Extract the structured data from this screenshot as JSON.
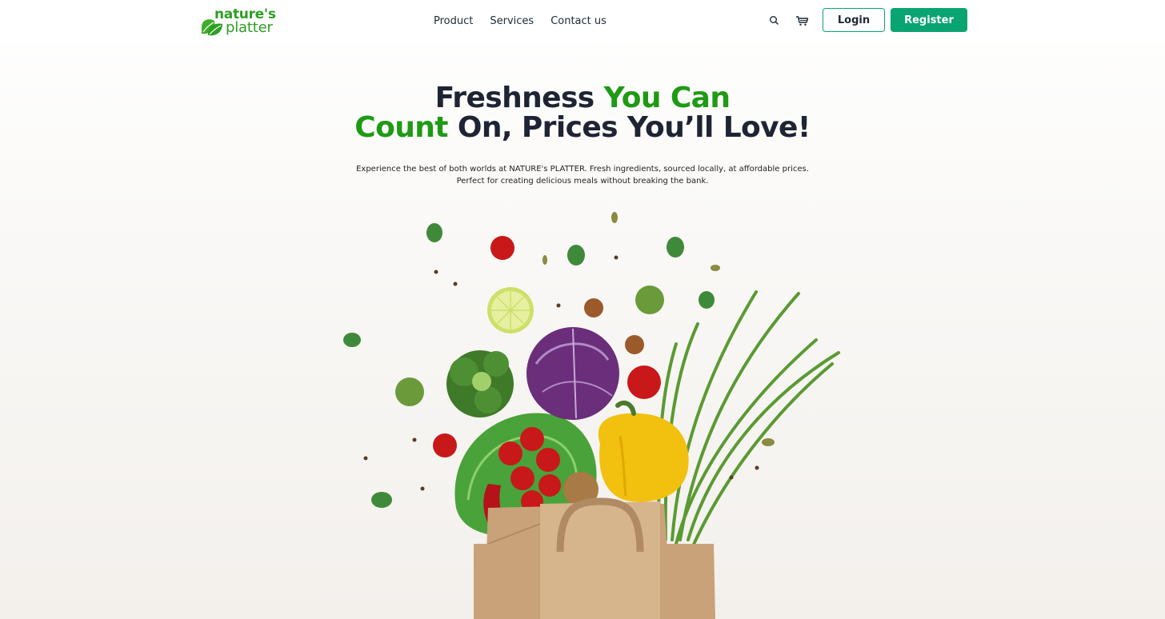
{
  "brand": {
    "line1": "nature's",
    "line2": "platter",
    "color": "#2e9e22"
  },
  "nav": {
    "items": [
      "Product",
      "Services",
      "Contact us"
    ]
  },
  "header_icons": [
    "search-icon",
    "cart-icon"
  ],
  "auth": {
    "login_label": "Login",
    "register_label": "Register",
    "accent": "#0aa472"
  },
  "hero": {
    "title_part1": "Freshness ",
    "title_part2": "You Can",
    "title_part3": "Count",
    "title_part4": " On, Prices You’ll Love!",
    "highlight_color": "#1f9a14",
    "subtitle_line1": "Experience the best of both worlds at NATURE's PLATTER. Fresh ingredients, sourced locally, at affordable prices.",
    "subtitle_line2": "Perfect for creating delicious meals without breaking the bank."
  }
}
